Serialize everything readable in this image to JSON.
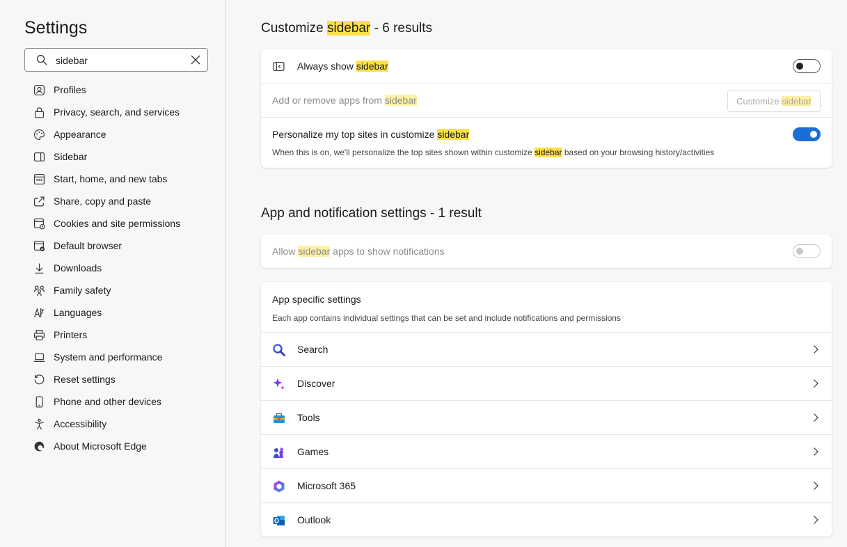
{
  "sidebar": {
    "title": "Settings",
    "search_value": "sidebar",
    "items": [
      {
        "label": "Profiles",
        "icon": "profile-icon"
      },
      {
        "label": "Privacy, search, and services",
        "icon": "lock-icon"
      },
      {
        "label": "Appearance",
        "icon": "palette-icon"
      },
      {
        "label": "Sidebar",
        "icon": "sidebar-icon"
      },
      {
        "label": "Start, home, and new tabs",
        "icon": "home-tabs-icon"
      },
      {
        "label": "Share, copy and paste",
        "icon": "share-icon"
      },
      {
        "label": "Cookies and site permissions",
        "icon": "cookies-icon"
      },
      {
        "label": "Default browser",
        "icon": "default-browser-icon"
      },
      {
        "label": "Downloads",
        "icon": "download-icon"
      },
      {
        "label": "Family safety",
        "icon": "family-icon"
      },
      {
        "label": "Languages",
        "icon": "languages-icon"
      },
      {
        "label": "Printers",
        "icon": "printer-icon"
      },
      {
        "label": "System and performance",
        "icon": "laptop-icon"
      },
      {
        "label": "Reset settings",
        "icon": "reset-icon"
      },
      {
        "label": "Phone and other devices",
        "icon": "phone-icon"
      },
      {
        "label": "Accessibility",
        "icon": "accessibility-icon"
      },
      {
        "label": "About Microsoft Edge",
        "icon": "edge-icon"
      }
    ]
  },
  "section1": {
    "title_pre": "Customize ",
    "title_hl": "sidebar",
    "title_post": " - 6 results",
    "always_show": {
      "pre": "Always show ",
      "hl": "sidebar",
      "toggle": "off"
    },
    "add_remove": {
      "pre": "Add or remove apps from ",
      "hl": "sidebar",
      "button_pre": "Customize ",
      "button_hl": "sidebar"
    },
    "personalize": {
      "pre": "Personalize my top sites in customize ",
      "hl": "sidebar",
      "desc_pre": "When this is on, we'll personalize the top sites shown within customize ",
      "desc_hl": "sidebar",
      "desc_post": " based on your browsing history/activities",
      "toggle": "on"
    }
  },
  "section2": {
    "title": "App and notification settings - 1 result",
    "allow": {
      "pre": "Allow ",
      "hl": "sidebar",
      "post": " apps to show notifications",
      "toggle": "disabled"
    }
  },
  "app_specific": {
    "title": "App specific settings",
    "desc": "Each app contains individual settings that can be set and include notifications and permissions",
    "apps": [
      {
        "label": "Search",
        "icon": "search-app-icon"
      },
      {
        "label": "Discover",
        "icon": "discover-icon"
      },
      {
        "label": "Tools",
        "icon": "tools-icon"
      },
      {
        "label": "Games",
        "icon": "games-icon"
      },
      {
        "label": "Microsoft 365",
        "icon": "microsoft-365-icon"
      },
      {
        "label": "Outlook",
        "icon": "outlook-icon"
      }
    ]
  },
  "colors": {
    "highlight": "#fde047",
    "toggle_on": "#1a6fd6"
  }
}
